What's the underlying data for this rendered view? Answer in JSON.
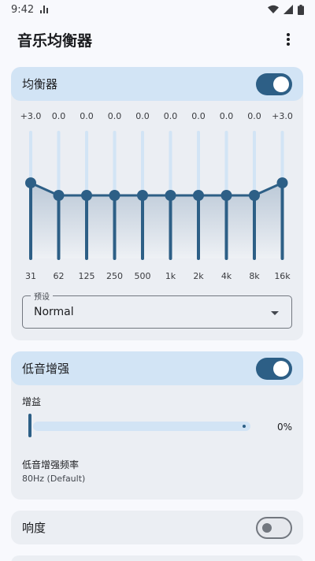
{
  "status_bar": {
    "time": "9:42"
  },
  "app_bar": {
    "title": "音乐均衡器"
  },
  "equalizer": {
    "title": "均衡器",
    "enabled": true,
    "bands": [
      {
        "freq": "31",
        "gain_label": "+3.0",
        "gain": 3.0
      },
      {
        "freq": "62",
        "gain_label": "0.0",
        "gain": 0.0
      },
      {
        "freq": "125",
        "gain_label": "0.0",
        "gain": 0.0
      },
      {
        "freq": "250",
        "gain_label": "0.0",
        "gain": 0.0
      },
      {
        "freq": "500",
        "gain_label": "0.0",
        "gain": 0.0
      },
      {
        "freq": "1k",
        "gain_label": "0.0",
        "gain": 0.0
      },
      {
        "freq": "2k",
        "gain_label": "0.0",
        "gain": 0.0
      },
      {
        "freq": "4k",
        "gain_label": "0.0",
        "gain": 0.0
      },
      {
        "freq": "8k",
        "gain_label": "0.0",
        "gain": 0.0
      },
      {
        "freq": "16k",
        "gain_label": "+3.0",
        "gain": 3.0
      }
    ],
    "preset": {
      "label": "预设",
      "value": "Normal"
    }
  },
  "bass_boost": {
    "title": "低音增强",
    "enabled": true,
    "gain_label": "增益",
    "gain_value": "0%",
    "frequency_label": "低音增强频率",
    "frequency_value": "80Hz (Default)"
  },
  "loudness": {
    "title": "响度",
    "enabled": false
  },
  "colors": {
    "accent": "#2d5f86",
    "header_bg": "#d2e4f5",
    "card_bg": "#ebeef3"
  }
}
